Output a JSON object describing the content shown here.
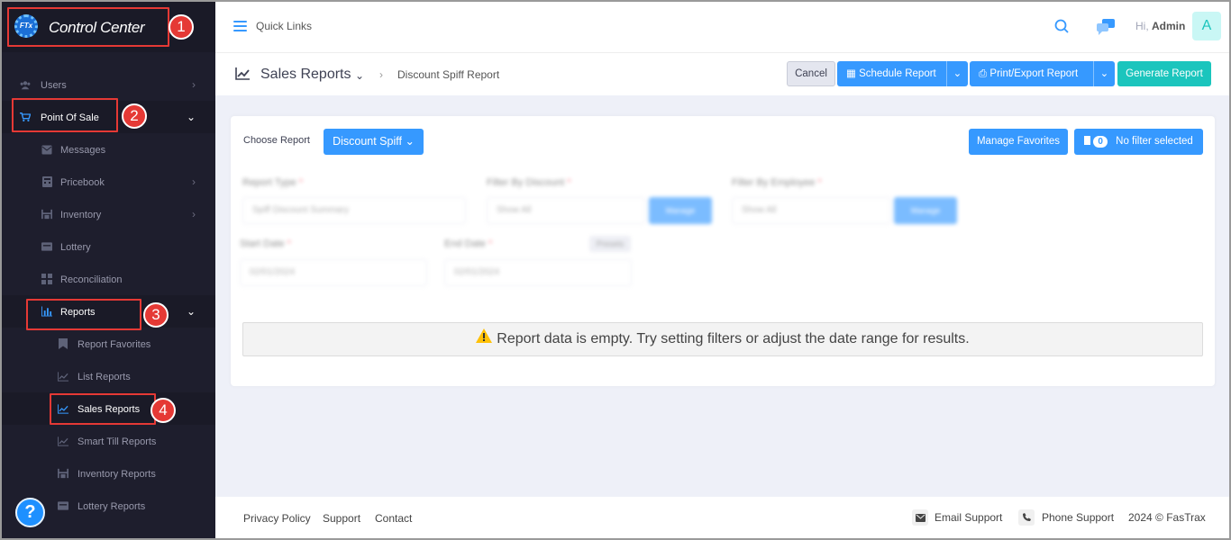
{
  "app": {
    "title": "Control Center",
    "logo_text": "FTx"
  },
  "sidebar": {
    "items": [
      {
        "label": "Users",
        "icon": "users-icon"
      },
      {
        "label": "Point Of Sale",
        "icon": "cart-icon"
      },
      {
        "label": "Messages",
        "icon": "envelope-icon"
      },
      {
        "label": "Pricebook",
        "icon": "calculator-icon"
      },
      {
        "label": "Inventory",
        "icon": "warehouse-icon"
      },
      {
        "label": "Lottery",
        "icon": "ticket-icon"
      },
      {
        "label": "Reconciliation",
        "icon": "grid-icon"
      },
      {
        "label": "Reports",
        "icon": "bar-chart-icon"
      },
      {
        "label": "Report Favorites",
        "icon": "bookmark-icon"
      },
      {
        "label": "List Reports",
        "icon": "line-chart-icon"
      },
      {
        "label": "Sales Reports",
        "icon": "line-chart-icon"
      },
      {
        "label": "Smart Till Reports",
        "icon": "line-chart-icon"
      },
      {
        "label": "Inventory Reports",
        "icon": "warehouse-icon"
      },
      {
        "label": "Lottery Reports",
        "icon": "ticket-icon"
      }
    ]
  },
  "annotations": [
    "1",
    "2",
    "3",
    "4"
  ],
  "help": {
    "label": "?"
  },
  "topbar": {
    "quick_links": "Quick Links",
    "greeting": "Hi,",
    "user": "Admin",
    "avatar_letter": "A"
  },
  "subheader": {
    "title": "Sales Reports",
    "breadcrumb": "Discount Spiff Report"
  },
  "actions": {
    "cancel": "Cancel",
    "schedule": "Schedule Report",
    "print_export": "Print/Export Report",
    "generate": "Generate Report"
  },
  "card": {
    "choose_label": "Choose Report",
    "report_select": "Discount Spiff",
    "manage_favorites": "Manage Favorites",
    "filter_count": "0",
    "filter_status": "No filter selected",
    "report_type_label": "Report Type",
    "report_type_value": "Spiff Discount Summary",
    "filter_discount_label": "Filter By Discount",
    "filter_discount_value": "Show All",
    "filter_discount_btn": "Manage",
    "filter_employee_label": "Filter By Employee",
    "filter_employee_value": "Show All",
    "filter_employee_btn": "Manage",
    "start_date_label": "Start Date",
    "start_date_value": "02/01/2024",
    "end_date_label": "End Date",
    "end_date_value": "02/01/2024",
    "preset_label": "Presets",
    "required_mark": "*",
    "empty_message": "Report data is empty. Try setting filters or adjust the date range for results."
  },
  "footer": {
    "privacy": "Privacy Policy",
    "support": "Support",
    "contact": "Contact",
    "email_support": "Email Support",
    "phone_support": "Phone Support",
    "copyright": "2024 © FasTrax"
  },
  "colors": {
    "accent": "#3699ff",
    "success": "#1bc5bd",
    "sidebar": "#1e1e2d",
    "annotation": "#e53935"
  }
}
